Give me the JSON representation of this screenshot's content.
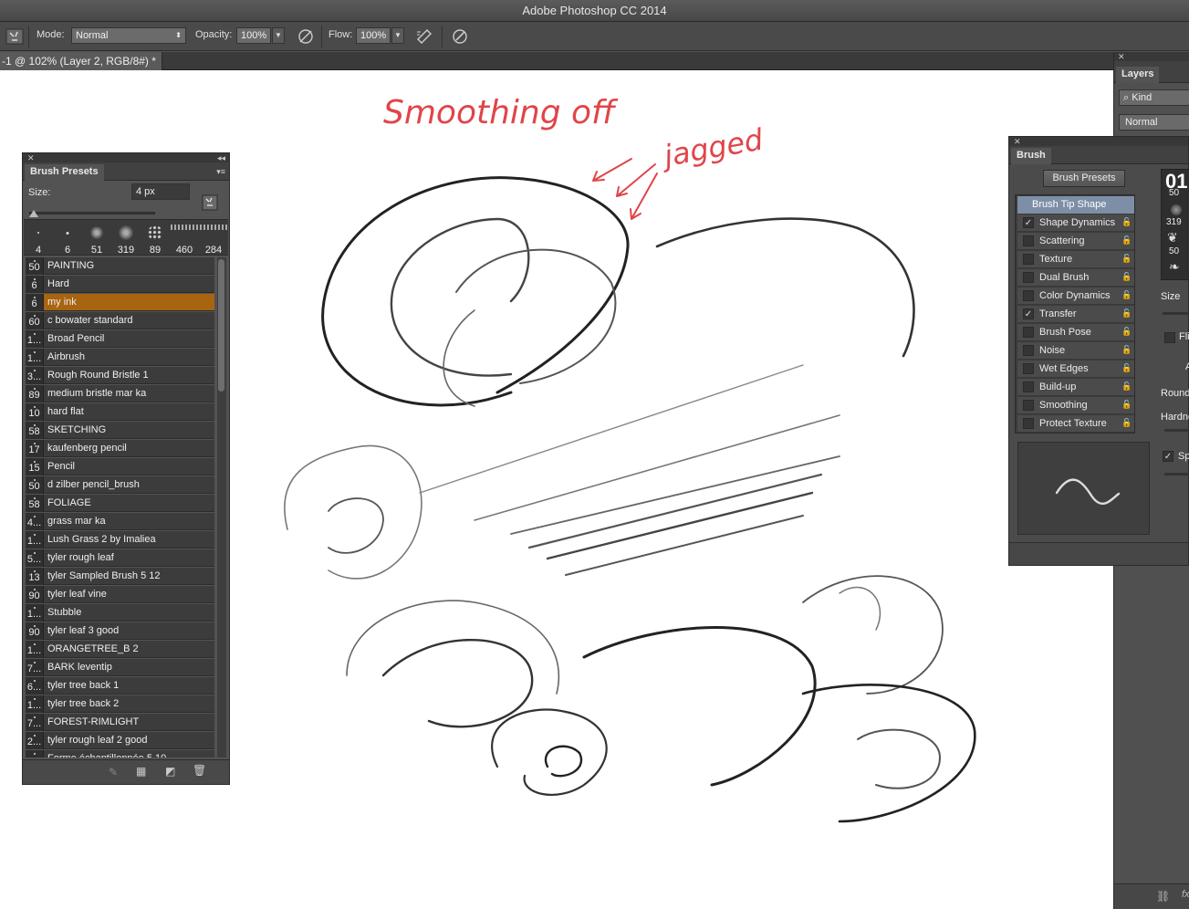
{
  "app": {
    "title": "Adobe Photoshop CC 2014"
  },
  "options": {
    "mode_label": "Mode:",
    "mode_value": "Normal",
    "opacity_label": "Opacity:",
    "opacity_value": "100%",
    "flow_label": "Flow:",
    "flow_value": "100%"
  },
  "document": {
    "tab_title": "-1 @ 102% (Layer 2, RGB/8#) *"
  },
  "canvas": {
    "annotation_main": "Smoothing off",
    "annotation_note": "jagged",
    "annotation_color": "#e0454a"
  },
  "brush_presets": {
    "panel_title": "Brush Presets",
    "size_label": "Size:",
    "size_value": "4 px",
    "tip_sizes": [
      "4",
      "6",
      "51",
      "319",
      "89",
      "460",
      "284"
    ],
    "list": [
      {
        "num": "50",
        "name": "PAINTING"
      },
      {
        "num": "6",
        "name": "Hard"
      },
      {
        "num": "6",
        "name": "my ink",
        "selected": true
      },
      {
        "num": "60",
        "name": "c bowater standard"
      },
      {
        "num": "1...",
        "name": "Broad Pencil"
      },
      {
        "num": "1...",
        "name": "Airbrush"
      },
      {
        "num": "3...",
        "name": "Rough Round Bristle 1"
      },
      {
        "num": "89",
        "name": "medium bristle mar ka"
      },
      {
        "num": "10",
        "name": "hard flat"
      },
      {
        "num": "58",
        "name": "SKETCHING"
      },
      {
        "num": "17",
        "name": "kaufenberg pencil"
      },
      {
        "num": "15",
        "name": "Pencil"
      },
      {
        "num": "50",
        "name": "d zilber pencil_brush"
      },
      {
        "num": "58",
        "name": "FOLIAGE"
      },
      {
        "num": "4...",
        "name": "grass  mar ka"
      },
      {
        "num": "1...",
        "name": "Lush Grass 2 by Imaliea"
      },
      {
        "num": "5...",
        "name": "tyler rough leaf"
      },
      {
        "num": "13",
        "name": "tyler Sampled Brush 5 12"
      },
      {
        "num": "90",
        "name": "tyler leaf  vine"
      },
      {
        "num": "1...",
        "name": "Stubble"
      },
      {
        "num": "90",
        "name": "tyler leaf 3 good"
      },
      {
        "num": "1...",
        "name": "ORANGETREE_B 2"
      },
      {
        "num": "7...",
        "name": "BARK leventip"
      },
      {
        "num": "6...",
        "name": "tyler tree back 1"
      },
      {
        "num": "1...",
        "name": "tyler tree back 2"
      },
      {
        "num": "7...",
        "name": "FOREST-RIMLIGHT"
      },
      {
        "num": "2...",
        "name": "tyler rough leaf 2 good"
      },
      {
        "num": "",
        "name": "Forme échantillonnée 5 10"
      }
    ],
    "selected_color": "#a86410"
  },
  "brush_panel": {
    "panel_title": "Brush",
    "presets_button": "Brush Presets",
    "tip_shape": "Brush Tip Shape",
    "options": [
      {
        "label": "Shape Dynamics",
        "checked": true
      },
      {
        "label": "Scattering",
        "checked": false
      },
      {
        "label": "Texture",
        "checked": false
      },
      {
        "label": "Dual Brush",
        "checked": false
      },
      {
        "label": "Color Dynamics",
        "checked": false
      },
      {
        "label": "Transfer",
        "checked": true
      },
      {
        "label": "Brush Pose",
        "checked": false
      },
      {
        "label": "Noise",
        "checked": false
      },
      {
        "label": "Wet Edges",
        "checked": false
      },
      {
        "label": "Build-up",
        "checked": false
      },
      {
        "label": "Smoothing",
        "checked": false
      },
      {
        "label": "Protect Texture",
        "checked": false
      }
    ],
    "tip_grid": [
      "01",
      "50",
      "319",
      "50"
    ],
    "size_label": "Size",
    "flip_label": "Fli",
    "round_label": "Round",
    "hardness_label": "Hardne",
    "spacing_label": "Sp",
    "a_label": "A"
  },
  "layers": {
    "panel_title": "Layers",
    "filter_label": "Kind",
    "blend_mode": "Normal",
    "fx_label": "fx"
  }
}
